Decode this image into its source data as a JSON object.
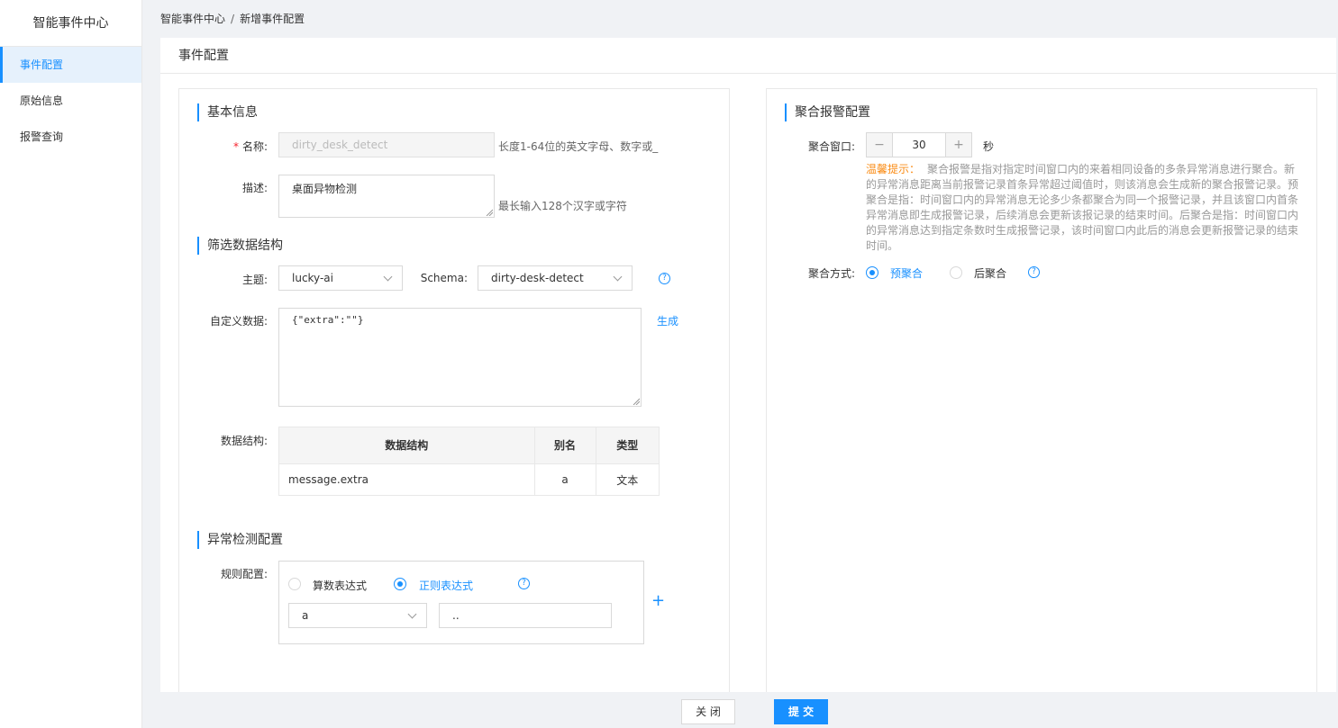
{
  "sidebar": {
    "title": "智能事件中心",
    "items": [
      {
        "label": "事件配置"
      },
      {
        "label": "原始信息"
      },
      {
        "label": "报警查询"
      }
    ]
  },
  "breadcrumb": {
    "root": "智能事件中心",
    "separator": "/",
    "current": "新增事件配置"
  },
  "page": {
    "title": "事件配置"
  },
  "basic": {
    "title": "基本信息",
    "name_label": "名称:",
    "name_required": "*",
    "name_value": "dirty_desk_detect",
    "name_hint": "长度1-64位的英文字母、数字或_",
    "desc_label": "描述:",
    "desc_value": "桌面异物检测",
    "desc_hint": "最长输入128个汉字或字符"
  },
  "filter": {
    "title": "筛选数据结构",
    "topic_label": "主题:",
    "topic_value": "lucky-ai",
    "schema_label": "Schema:",
    "schema_value": "dirty-desk-detect",
    "custom_label": "自定义数据:",
    "custom_value": "{\"extra\":\"\"}",
    "generate_label": "生成",
    "ds_label": "数据结构:",
    "table": {
      "headers": [
        "数据结构",
        "别名",
        "类型"
      ],
      "rows": [
        [
          "message.extra",
          "a",
          "文本"
        ]
      ]
    }
  },
  "anomaly": {
    "title": "异常检测配置",
    "rule_label": "规则配置:",
    "option_arith": "算数表达式",
    "option_regex": "正则表达式",
    "selected": "正则表达式",
    "field_value": "a",
    "expr_value": ".."
  },
  "aggregation": {
    "title": "聚合报警配置",
    "window_label": "聚合窗口:",
    "window_value": "30",
    "window_unit": "秒",
    "minus": "−",
    "plus": "+",
    "tip_head": "温馨提示：",
    "tip_body": "聚合报警是指对指定时间窗口内的来着相同设备的多条异常消息进行聚合。新的异常消息距离当前报警记录首条异常超过阈值时，则该消息会生成新的聚合报警记录。预聚合是指：时间窗口内的异常消息无论多少条都聚合为同一个报警记录，并且该窗口内首条异常消息即生成报警记录，后续消息会更新该报记录的结束时间。后聚合是指：时间窗口内的异常消息达到指定条数时生成报警记录，该时间窗口内此后的消息会更新报警记录的结束时间。",
    "mode_label": "聚合方式:",
    "mode_pre": "预聚合",
    "mode_post": "后聚合",
    "selected": "预聚合"
  },
  "help_glyph": "?",
  "footer": {
    "close_label": "关 闭",
    "submit_label": "提 交"
  },
  "colors": {
    "accent": "#1890ff",
    "warning": "#fa8c16",
    "required": "#f5222d"
  },
  "icons": [
    "chevron-down-icon",
    "help-circle-icon",
    "plus-icon",
    "minus-icon"
  ]
}
